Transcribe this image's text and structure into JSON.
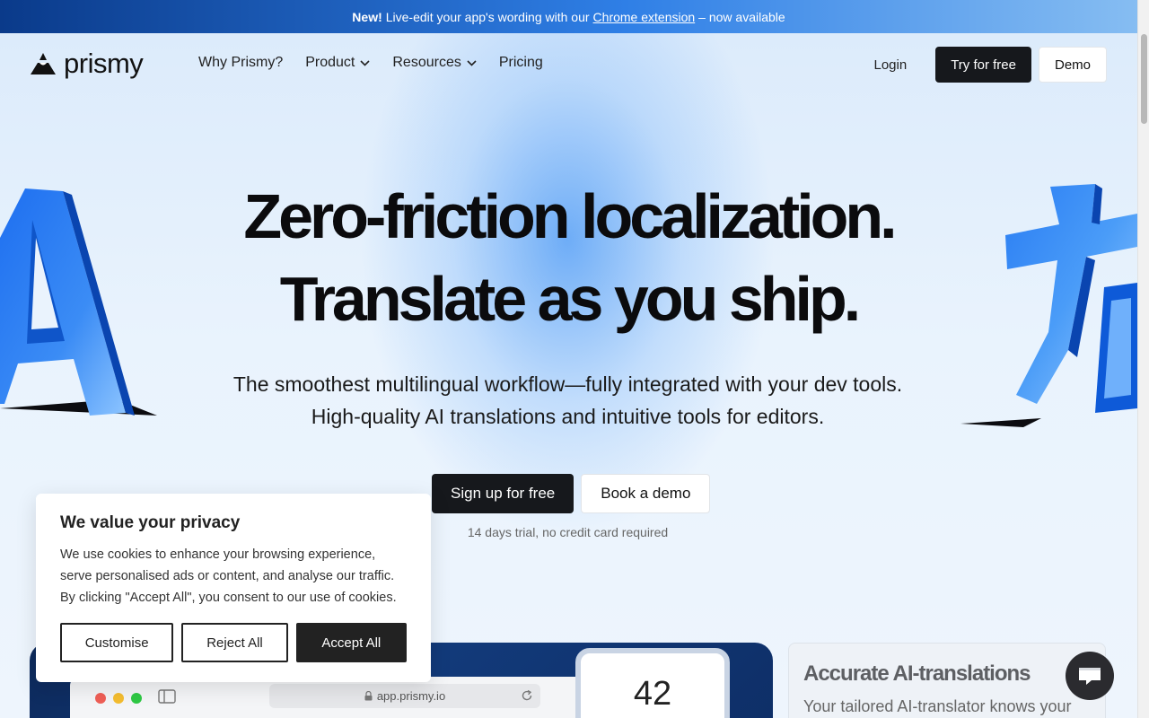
{
  "announcement": {
    "bold": "New!",
    "text": "Live-edit your app's wording with our",
    "link": "Chrome extension",
    "suffix": "– now available"
  },
  "brand": {
    "name": "prismy"
  },
  "nav": {
    "links": [
      "Why Prismy?",
      "Product",
      "Resources",
      "Pricing"
    ],
    "login": "Login",
    "try_free": "Try for free",
    "demo": "Demo"
  },
  "hero": {
    "headline_1": "Zero-friction localization.",
    "headline_2": "Translate as you ship.",
    "sub_1": "The smoothest multilingual workflow—fully integrated with your dev tools.",
    "sub_2": "High-quality AI translations and intuitive tools for editors.",
    "cta_primary": "Sign up for free",
    "cta_secondary": "Book a demo",
    "trial_note": "14 days trial, no credit card required"
  },
  "preview": {
    "url": "app.prismy.io",
    "counter": "42"
  },
  "feature": {
    "title": "Accurate AI-translations",
    "text": "Your tailored AI-translator knows your"
  },
  "cookie": {
    "title": "We value your privacy",
    "body": "We use cookies to enhance your browsing experience, serve personalised ads or content, and analyse our traffic. By clicking \"Accept All\", you consent to our use of cookies.",
    "customise": "Customise",
    "reject": "Reject All",
    "accept": "Accept All"
  },
  "colors": {
    "accent_blue": "#2f7fe6",
    "dark_button": "#16181c"
  }
}
